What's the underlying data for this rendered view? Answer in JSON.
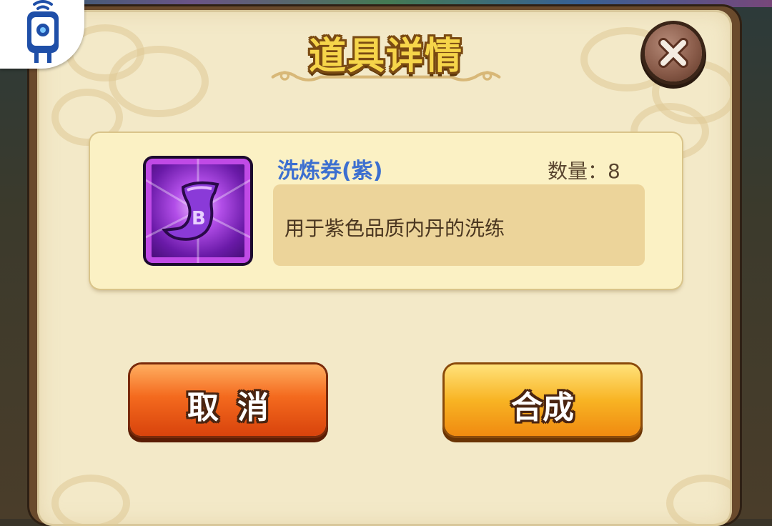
{
  "dialog": {
    "title": "道具详情",
    "close_icon": "close-x-icon"
  },
  "item": {
    "icon": "purple-scroll-icon",
    "name": "洗炼券(紫)",
    "quantity_label": "数量：",
    "quantity_value": "8",
    "description": "用于紫色品质内丹的洗练"
  },
  "buttons": {
    "cancel_label": "取消",
    "compose_label": "合成"
  },
  "colors": {
    "item_name": "#3c6fd0",
    "title_fill": "#f6d54a",
    "cancel_button": "#f46a1e",
    "compose_button": "#f8b424"
  }
}
